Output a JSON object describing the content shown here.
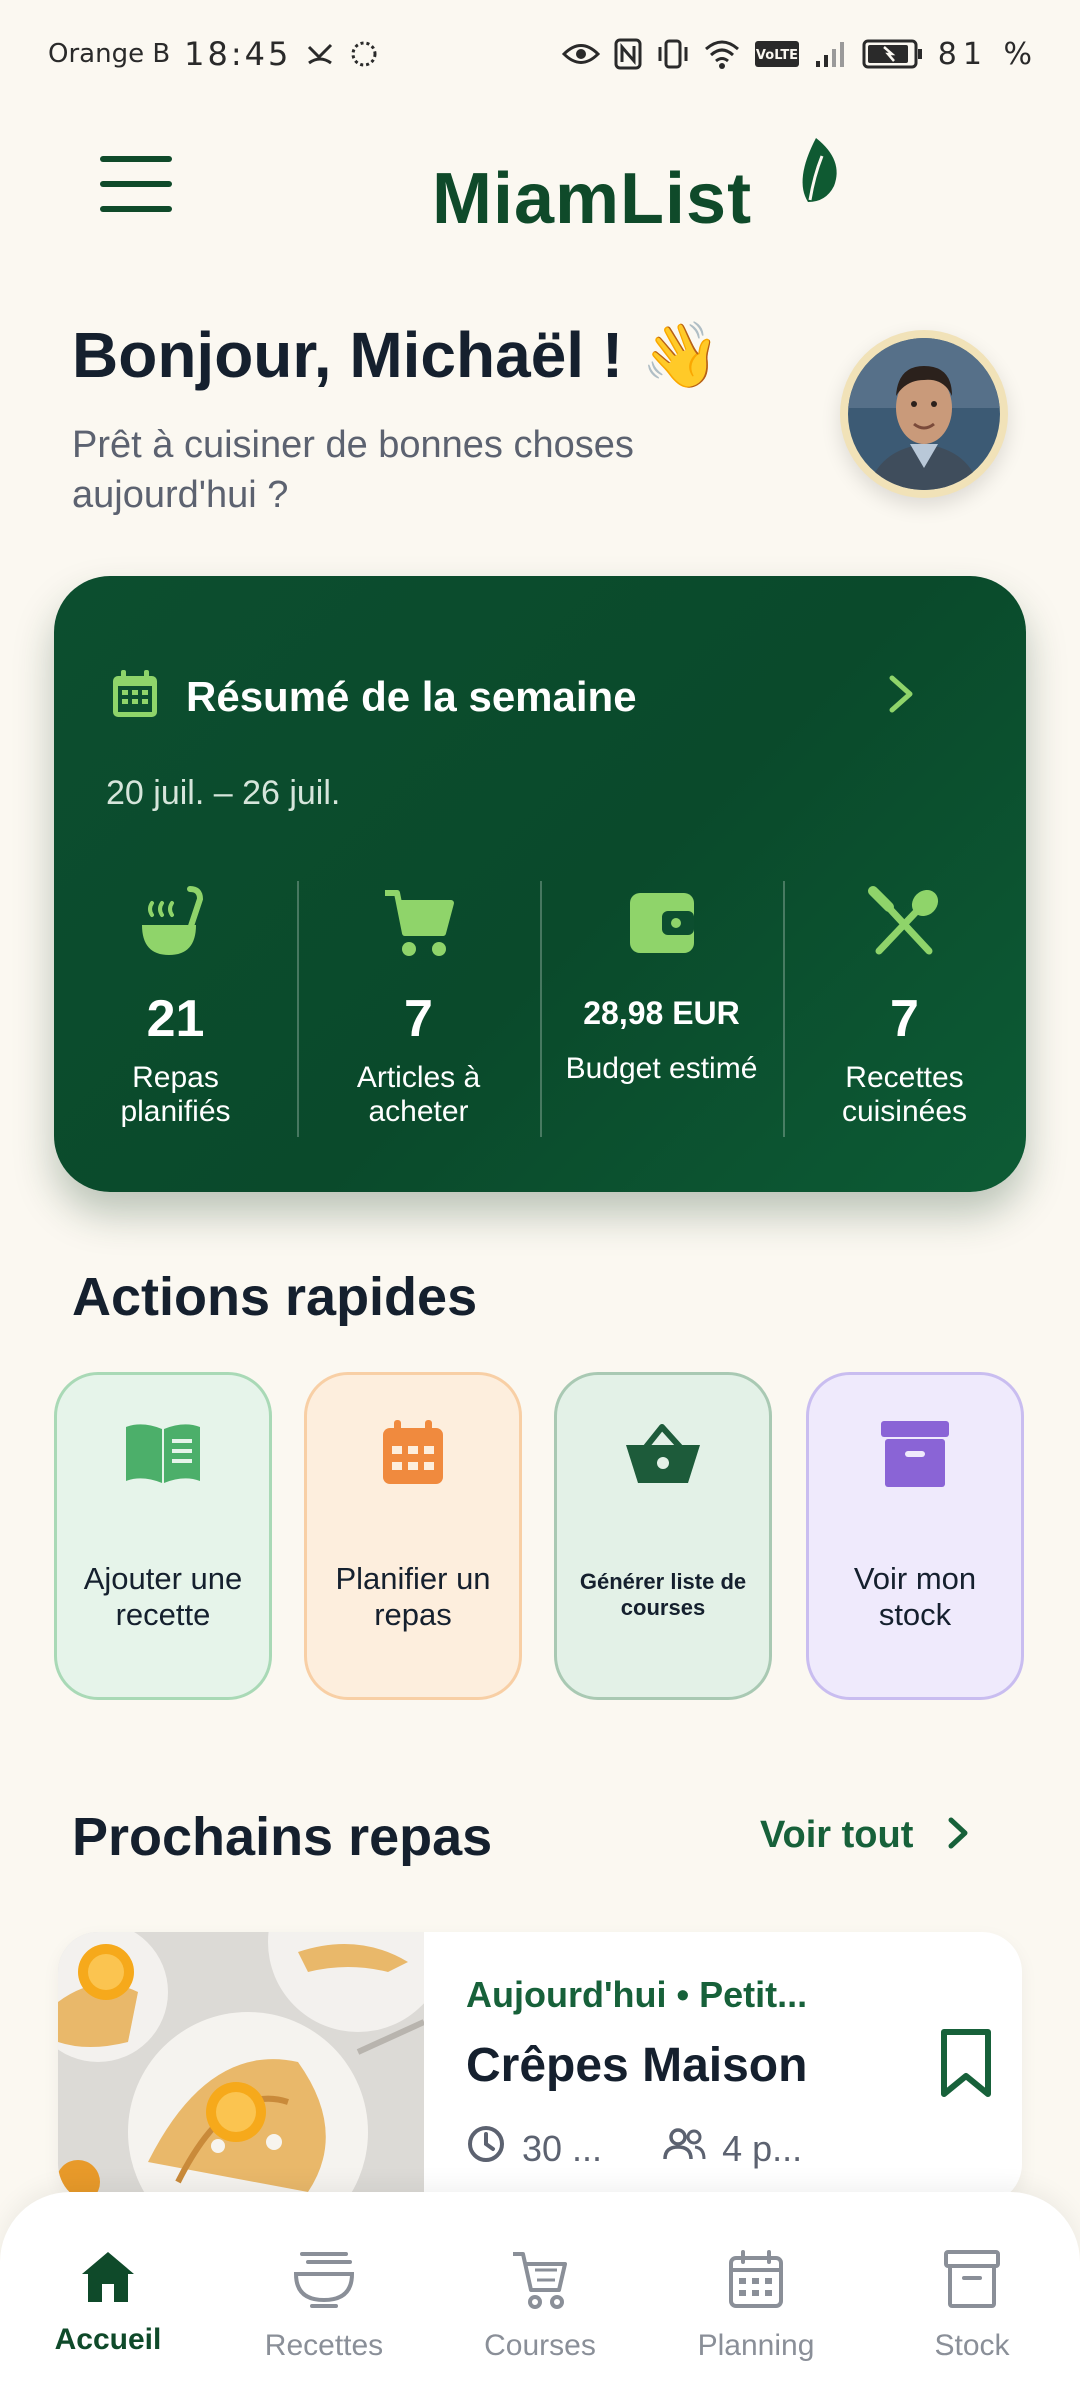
{
  "status_bar": {
    "carrier": "Orange B",
    "time": "18:45",
    "battery": "81 %",
    "icons": [
      "missed-call-icon",
      "sync-icon",
      "eye-icon",
      "nfc-icon",
      "vibrate-icon",
      "wifi-icon",
      "volte-icon",
      "signal-icon",
      "battery-icon"
    ],
    "volte_label": "VoLTE"
  },
  "header": {
    "app_name": "MiamList",
    "menu_icon": "hamburger-menu-icon",
    "logo_icon": "leaf-icon"
  },
  "greeting": {
    "title": "Bonjour, Michaël ! 👋",
    "subtitle": "Prêt à cuisiner de bonnes choses aujourd'hui ?"
  },
  "summary": {
    "title": "Résumé de la semaine",
    "dates": "20 juil. – 26 juil.",
    "icon": "calendar-icon",
    "stats": [
      {
        "value": "21",
        "label": "Repas planifiés",
        "icon": "ladle-icon"
      },
      {
        "value": "7",
        "label": "Articles à acheter",
        "icon": "cart-icon"
      },
      {
        "value": "28,98 EUR",
        "label": "Budget estimé",
        "icon": "wallet-icon"
      },
      {
        "value": "7",
        "label": "Recettes cuisinées",
        "icon": "utensils-icon"
      }
    ]
  },
  "quick_actions": {
    "title": "Actions rapides",
    "items": [
      {
        "label": "Ajouter une recette",
        "icon": "book-icon",
        "bg": "#e6f4ea",
        "border": "#a9d9b6",
        "color": "#4caf6a"
      },
      {
        "label": "Planifier un repas",
        "icon": "calendar-icon",
        "bg": "#fdeedd",
        "border": "#f8cfa5",
        "color": "#f08a3e"
      },
      {
        "label": "Générer liste de courses",
        "icon": "basket-icon",
        "bg": "#e3f1e7",
        "border": "#a9c9b3",
        "color": "#1d5b3a"
      },
      {
        "label": "Voir mon stock",
        "icon": "archive-box-icon",
        "bg": "#efeafc",
        "border": "#c9bdf0",
        "color": "#8a64d6"
      }
    ]
  },
  "upcoming": {
    "title": "Prochains repas",
    "see_all": "Voir tout",
    "meal": {
      "tag": "Aujourd'hui • Petit...",
      "name": "Crêpes Maison",
      "time": "30 ...",
      "servings": "4 p..."
    }
  },
  "bottom_nav": {
    "items": [
      {
        "label": "Accueil",
        "icon": "home-icon",
        "active": true
      },
      {
        "label": "Recettes",
        "icon": "bowl-icon",
        "active": false
      },
      {
        "label": "Courses",
        "icon": "cart-icon",
        "active": false
      },
      {
        "label": "Planning",
        "icon": "calendar-icon",
        "active": false
      },
      {
        "label": "Stock",
        "icon": "archive-box-icon",
        "active": false
      }
    ]
  },
  "colors": {
    "brand": "#0f4a2a",
    "accent": "#17613a",
    "background": "#fbf8f1"
  }
}
